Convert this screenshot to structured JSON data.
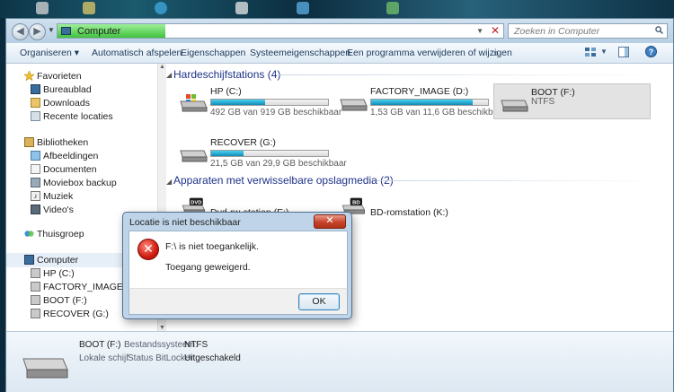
{
  "address": {
    "location": "Computer"
  },
  "search": {
    "placeholder": "Zoeken in Computer"
  },
  "toolbar": {
    "organize": "Organiseren",
    "autoplay": "Automatisch afspelen",
    "properties": "Eigenschappen",
    "system_properties": "Systeemeigenschappen",
    "uninstall": "Een programma verwijderen of wijzigen",
    "more": "»"
  },
  "sidebar": {
    "favorites": "Favorieten",
    "favorites_items": [
      "Bureaublad",
      "Downloads",
      "Recente locaties"
    ],
    "libraries": "Bibliotheken",
    "libraries_items": [
      "Afbeeldingen",
      "Documenten",
      "Moviebox backup",
      "Muziek",
      "Video's"
    ],
    "homegroup": "Thuisgroep",
    "computer": "Computer",
    "computer_items": [
      "HP (C:)",
      "FACTORY_IMAGE (D:)",
      "BOOT (F:)",
      "RECOVER (G:)"
    ]
  },
  "groups": {
    "hard_drives": "Hardeschijfstations (4)",
    "removable": "Apparaten met verwisselbare opslagmedia (2)"
  },
  "drives": [
    {
      "name": "HP (C:)",
      "free": "492 GB van 919 GB beschikbaar",
      "used_fraction": 0.46
    },
    {
      "name": "FACTORY_IMAGE (D:)",
      "free": "1,53 GB van 11,6 GB beschikbaar",
      "used_fraction": 0.87
    },
    {
      "name": "BOOT (F:)",
      "fs": "NTFS"
    },
    {
      "name": "RECOVER (G:)",
      "free": "21,5 GB van 29,9 GB beschikbaar",
      "used_fraction": 0.28
    }
  ],
  "removable": [
    {
      "name": "Dvd-rw-station (E:)",
      "badge": "DVD"
    },
    {
      "name": "BD-romstation (K:)",
      "badge": "BD"
    }
  ],
  "details": {
    "name": "BOOT (F:)",
    "type": "Lokale schijf",
    "fs_label": "Bestandssysteem:",
    "fs_value": "NTFS",
    "bitlocker_label": "Status BitLocker:",
    "bitlocker_value": "Uitgeschakeld"
  },
  "dialog": {
    "title": "Locatie is niet beschikbaar",
    "close": "✕",
    "message1": "F:\\ is niet toegankelijk.",
    "message2": "Toegang geweigerd.",
    "ok": "OK"
  },
  "colors": {
    "accent": "#1e3287",
    "error": "#d01c10",
    "bar": "#1389b6"
  }
}
